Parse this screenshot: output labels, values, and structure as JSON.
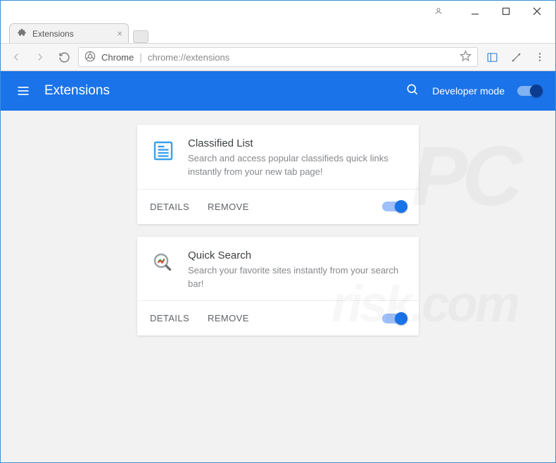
{
  "window": {
    "tab_title": "Extensions"
  },
  "omnibox": {
    "scheme_label": "Chrome",
    "url": "chrome://extensions"
  },
  "header": {
    "title": "Extensions",
    "dev_mode_label": "Developer mode"
  },
  "extensions": [
    {
      "name": "Classified List",
      "description": "Search and access popular classifieds quick links instantly from your new tab page!",
      "details_label": "DETAILS",
      "remove_label": "REMOVE",
      "enabled": true,
      "icon": "newspaper"
    },
    {
      "name": "Quick Search",
      "description": "Search your favorite sites instantly from your search bar!",
      "details_label": "DETAILS",
      "remove_label": "REMOVE",
      "enabled": true,
      "icon": "magnifier"
    }
  ],
  "watermark": {
    "line1": "PC",
    "line2": "risk.com"
  }
}
